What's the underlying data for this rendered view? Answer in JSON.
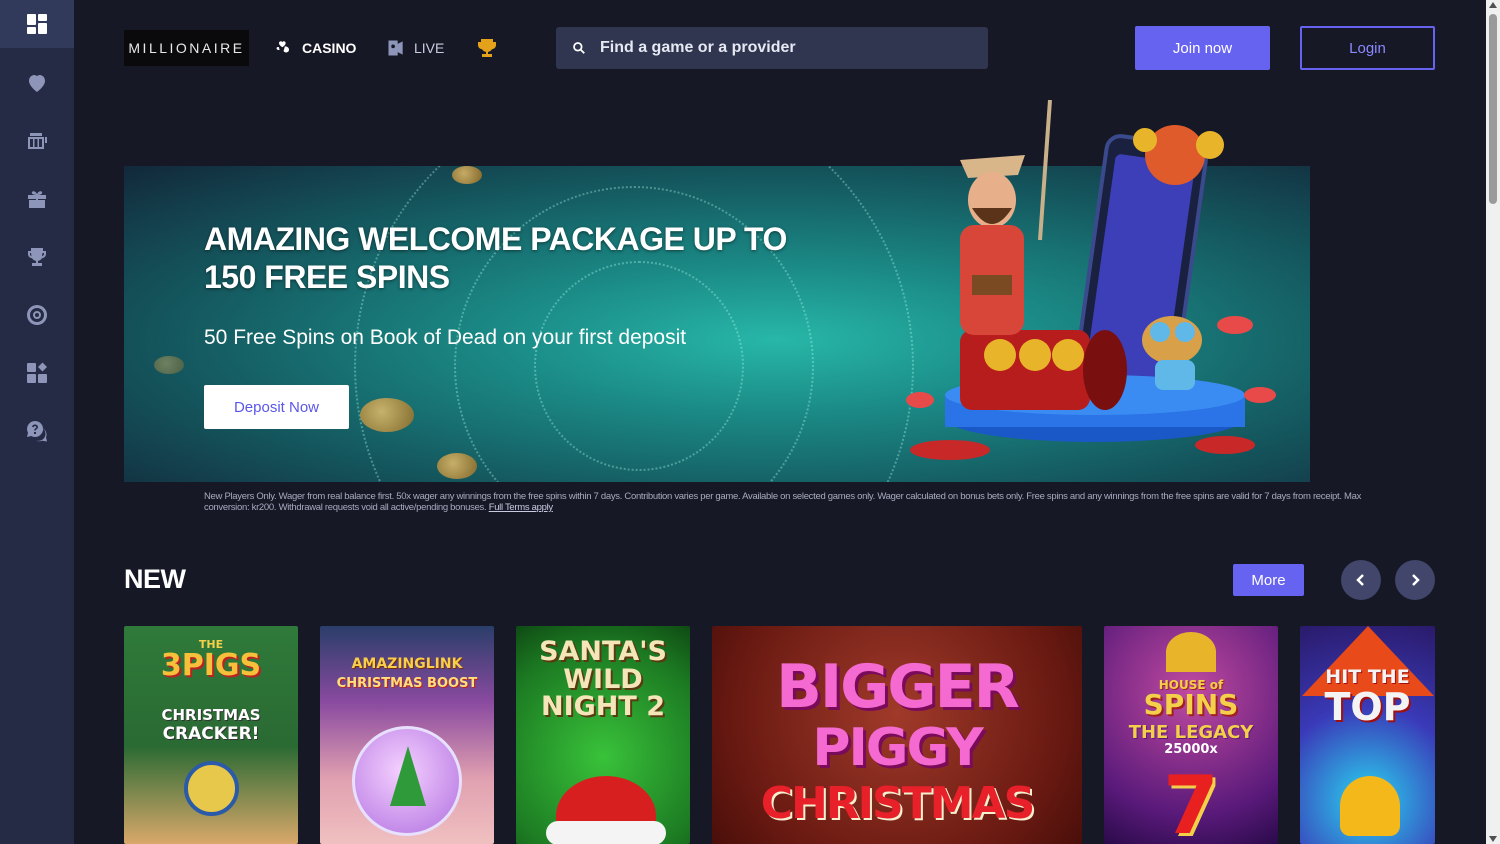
{
  "sidebar": {
    "items": [
      {
        "icon": "dashboard-icon",
        "active": true
      },
      {
        "icon": "heart-icon"
      },
      {
        "icon": "slot-machine-icon"
      },
      {
        "icon": "gift-icon"
      },
      {
        "icon": "trophy-icon"
      },
      {
        "icon": "target-icon"
      },
      {
        "icon": "widgets-icon"
      },
      {
        "icon": "help-icon"
      }
    ]
  },
  "header": {
    "logo": "MILLIONAIRE",
    "nav": {
      "casino": "CASINO",
      "live": "LIVE"
    },
    "search_placeholder": "Find a game or a provider",
    "join_label": "Join now",
    "login_label": "Login"
  },
  "banner": {
    "title_line1": "AMAZING WELCOME PACKAGE UP TO",
    "title_line2": "150 FREE SPINS",
    "subtitle": "50 Free Spins on Book of Dead on your first deposit",
    "cta": "Deposit Now",
    "terms": "New Players Only. Wager from real balance first. 50x wager any winnings from the free spins within 7 days. Contribution varies per game. Available on selected games only. Wager calculated on bonus bets only. Free spins and any winnings from the free spins are valid for 7 days from receipt. Max conversion: kr200. Withdrawal requests void all active/pending bonuses.",
    "terms_link": "Full Terms apply"
  },
  "section_new": {
    "title": "NEW",
    "more_label": "More"
  },
  "games": [
    {
      "line1": "THE",
      "line2": "3PIGS",
      "line3": "CHRISTMAS",
      "line4": "CRACKER!"
    },
    {
      "line1": "AMAZINGLINK",
      "line2": "CHRISTMAS BOOST"
    },
    {
      "line1": "SANTA'S",
      "line2": "WILD",
      "line3": "NIGHT 2"
    },
    {
      "line1": "BIGGER",
      "line2": "PIGGY",
      "line3": "CHRISTMAS"
    },
    {
      "line1": "HOUSE of",
      "line2": "SPINS",
      "line3": "THE LEGACY",
      "line4": "25000x"
    },
    {
      "line1": "HIT THE",
      "line2": "TOP"
    }
  ],
  "colors": {
    "accent": "#6763f1",
    "sidebar": "#252b45",
    "background": "#161826",
    "search": "#303650"
  }
}
